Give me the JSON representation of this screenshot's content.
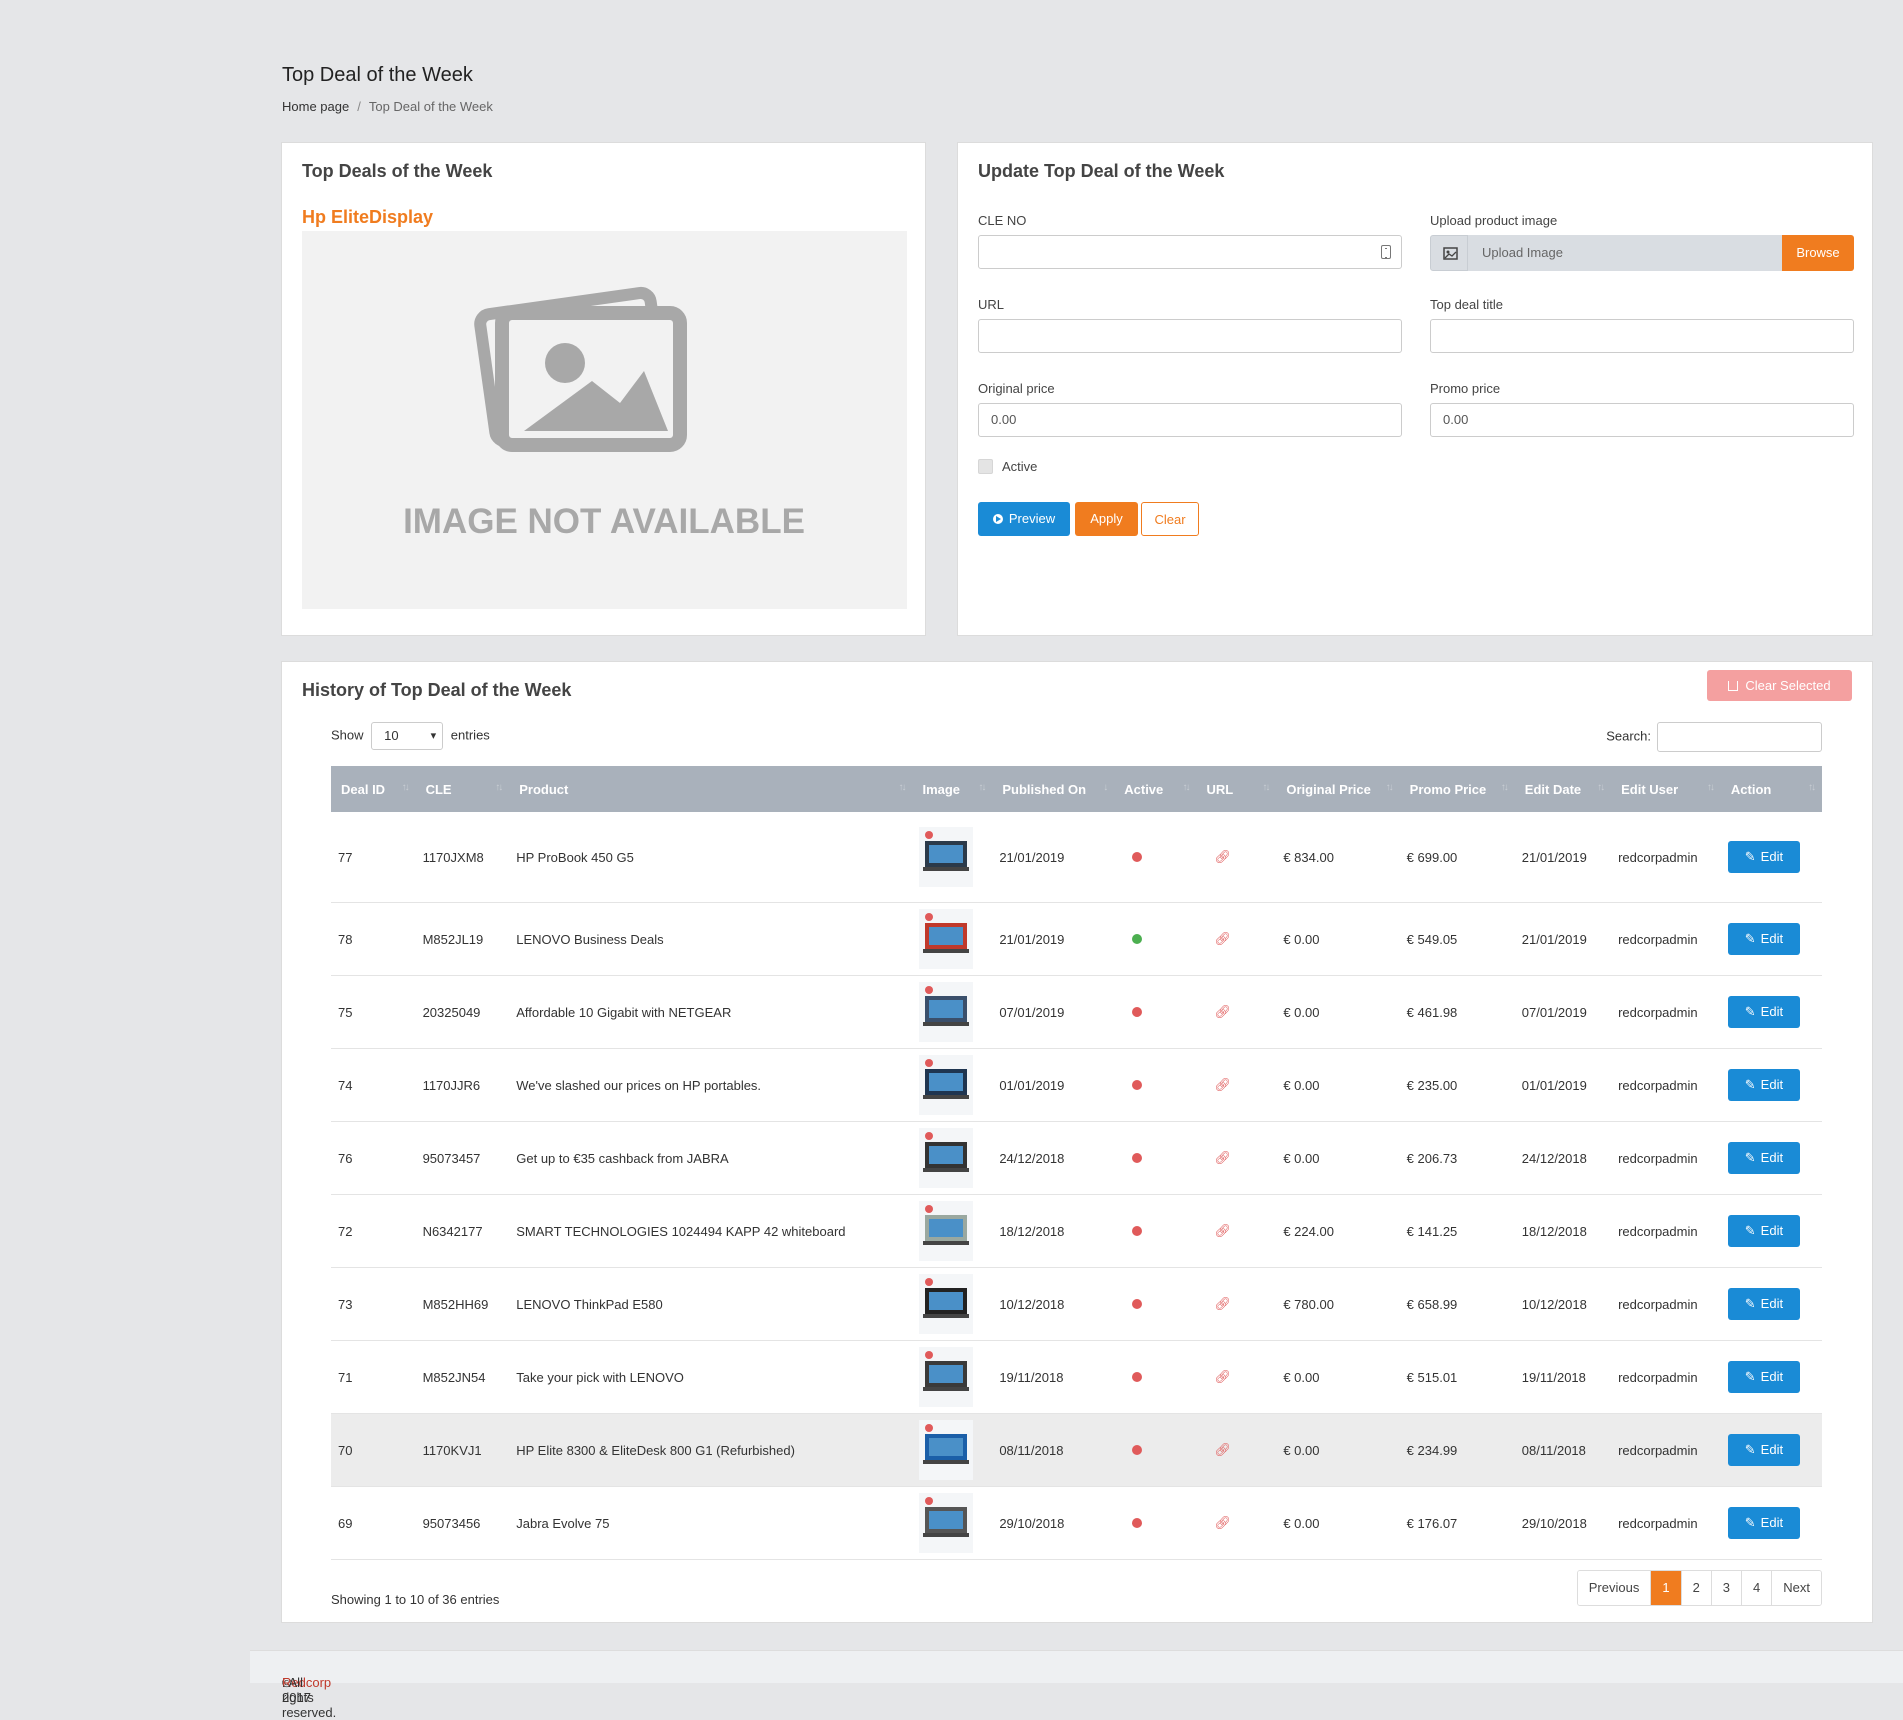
{
  "header": {
    "title": "Top Deal of the Week",
    "breadcrumb": {
      "home": "Home page",
      "separator": "/",
      "current": "Top Deal of the Week"
    }
  },
  "preview_card": {
    "title": "Top Deals of the Week",
    "deal_name": "Hp EliteDisplay",
    "image_placeholder_text": "IMAGE NOT AVAILABLE"
  },
  "form_card": {
    "title": "Update Top Deal of the Week",
    "cle_no": {
      "label": "CLE NO",
      "value": ""
    },
    "upload": {
      "label": "Upload product image",
      "placeholder": "Upload Image",
      "browse": "Browse"
    },
    "url": {
      "label": "URL",
      "value": ""
    },
    "deal_title": {
      "label": "Top deal title",
      "value": ""
    },
    "original_price": {
      "label": "Original price",
      "value": "0.00"
    },
    "promo_price": {
      "label": "Promo price",
      "value": "0.00"
    },
    "active": {
      "label": "Active",
      "checked": false
    },
    "buttons": {
      "preview": "Preview",
      "apply": "Apply",
      "clear": "Clear"
    }
  },
  "history": {
    "title": "History of Top Deal of the Week",
    "clear_selected": "Clear Selected",
    "show_label": "Show",
    "entries_value": "10",
    "entries_label": "entries",
    "search_label": "Search:",
    "columns": [
      "Deal ID",
      "CLE",
      "Product",
      "Image",
      "Published On",
      "Active",
      "URL",
      "Original Price",
      "Promo Price",
      "Edit Date",
      "Edit User",
      "Action"
    ],
    "rows": [
      {
        "id": "77",
        "cle": "1170JXM8",
        "product": "HP ProBook 450 G5",
        "published": "21/01/2019",
        "active": false,
        "original": "€ 834.00",
        "promo": "€ 699.00",
        "edit_date": "21/01/2019",
        "user": "redcorpadmin"
      },
      {
        "id": "78",
        "cle": "M852JL19",
        "product": "LENOVO Business Deals",
        "published": "21/01/2019",
        "active": true,
        "original": "€ 0.00",
        "promo": "€ 549.05",
        "edit_date": "21/01/2019",
        "user": "redcorpadmin"
      },
      {
        "id": "75",
        "cle": "20325049",
        "product": "Affordable 10 Gigabit with NETGEAR",
        "published": "07/01/2019",
        "active": false,
        "original": "€ 0.00",
        "promo": "€ 461.98",
        "edit_date": "07/01/2019",
        "user": "redcorpadmin"
      },
      {
        "id": "74",
        "cle": "1170JJR6",
        "product": "We've slashed our prices on HP portables.",
        "published": "01/01/2019",
        "active": false,
        "original": "€ 0.00",
        "promo": "€ 235.00",
        "edit_date": "01/01/2019",
        "user": "redcorpadmin"
      },
      {
        "id": "76",
        "cle": "95073457",
        "product": "Get up to €35 cashback from JABRA",
        "published": "24/12/2018",
        "active": false,
        "original": "€ 0.00",
        "promo": "€ 206.73",
        "edit_date": "24/12/2018",
        "user": "redcorpadmin"
      },
      {
        "id": "72",
        "cle": "N6342177",
        "product": "SMART TECHNOLOGIES 1024494 KAPP 42 whiteboard",
        "published": "18/12/2018",
        "active": false,
        "original": "€ 224.00",
        "promo": "€ 141.25",
        "edit_date": "18/12/2018",
        "user": "redcorpadmin"
      },
      {
        "id": "73",
        "cle": "M852HH69",
        "product": "LENOVO ThinkPad E580",
        "published": "10/12/2018",
        "active": false,
        "original": "€ 780.00",
        "promo": "€ 658.99",
        "edit_date": "10/12/2018",
        "user": "redcorpadmin"
      },
      {
        "id": "71",
        "cle": "M852JN54",
        "product": "Take your pick with LENOVO",
        "published": "19/11/2018",
        "active": false,
        "original": "€ 0.00",
        "promo": "€ 515.01",
        "edit_date": "19/11/2018",
        "user": "redcorpadmin"
      },
      {
        "id": "70",
        "cle": "1170KVJ1",
        "product": "HP Elite 8300 & EliteDesk 800 G1 (Refurbished)",
        "published": "08/11/2018",
        "active": false,
        "original": "€ 0.00",
        "promo": "€ 234.99",
        "edit_date": "08/11/2018",
        "user": "redcorpadmin"
      },
      {
        "id": "69",
        "cle": "95073456",
        "product": "Jabra Evolve 75",
        "published": "29/10/2018",
        "active": false,
        "original": "€ 0.00",
        "promo": "€ 176.07",
        "edit_date": "29/10/2018",
        "user": "redcorpadmin"
      }
    ],
    "edit_label": "Edit",
    "showing_text": "Showing 1 to 10 of 36 entries",
    "pagination": {
      "previous": "Previous",
      "pages": [
        "1",
        "2",
        "3",
        "4"
      ],
      "active_page": "1",
      "next": "Next"
    }
  },
  "footer": {
    "prefix": "© 2017 ",
    "brand": "Redcorp",
    "suffix": ". All rights reserved."
  },
  "colors": {
    "accent": "#f07c1f",
    "primary": "#1a8bd6",
    "active_dot": "#4caf50",
    "inactive_dot": "#e05a5a",
    "header_bg": "#a9b1bb"
  }
}
